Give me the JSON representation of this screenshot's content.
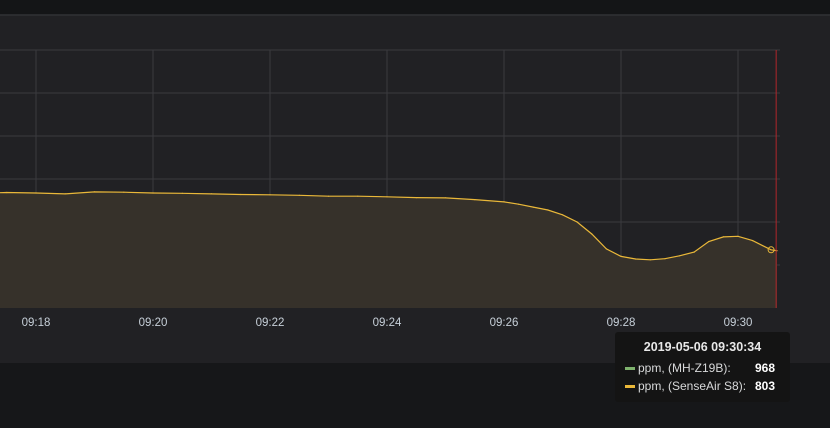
{
  "colors": {
    "senseair": "#eab839",
    "mhz19b": "#7eb26d",
    "cursor": "#b0262b",
    "grid": "#3a3b3e",
    "fill": "#36312a"
  },
  "tooltip": {
    "time": "2019-05-06 09:30:34",
    "rows": [
      {
        "name": "ppm, (MH-Z19B):",
        "value": "968"
      },
      {
        "name": "ppm, (SenseAir S8):",
        "value": "803"
      }
    ]
  },
  "chart_data": {
    "type": "area",
    "x_range": [
      "09:17",
      "09:30:40"
    ],
    "x_ticks": [
      "09:18",
      "09:20",
      "09:22",
      "09:24",
      "09:26",
      "09:28",
      "09:30"
    ],
    "grid": true,
    "legend": "tooltip",
    "cursor_time": "09:30:34",
    "series": [
      {
        "name": "ppm, (SenseAir S8)",
        "x": [
          "09:17:00",
          "09:17:30",
          "09:18:00",
          "09:18:30",
          "09:19:00",
          "09:19:30",
          "09:20:00",
          "09:20:30",
          "09:21:00",
          "09:21:30",
          "09:22:00",
          "09:22:30",
          "09:23:00",
          "09:23:30",
          "09:24:00",
          "09:24:30",
          "09:25:00",
          "09:25:30",
          "09:26:00",
          "09:26:15",
          "09:26:30",
          "09:26:45",
          "09:27:00",
          "09:27:15",
          "09:27:30",
          "09:27:45",
          "09:28:00",
          "09:28:15",
          "09:28:30",
          "09:28:45",
          "09:29:00",
          "09:29:15",
          "09:29:30",
          "09:29:45",
          "09:30:00",
          "09:30:15",
          "09:30:34",
          "09:30:40"
        ],
        "values": [
          1000,
          1003,
          1001,
          998,
          1005,
          1004,
          1001,
          1000,
          998,
          996,
          995,
          993,
          990,
          990,
          988,
          985,
          984,
          978,
          970,
          962,
          952,
          942,
          925,
          900,
          858,
          806,
          780,
          771,
          768,
          772,
          782,
          795,
          832,
          848,
          850,
          835,
          803,
          800
        ]
      }
    ]
  }
}
